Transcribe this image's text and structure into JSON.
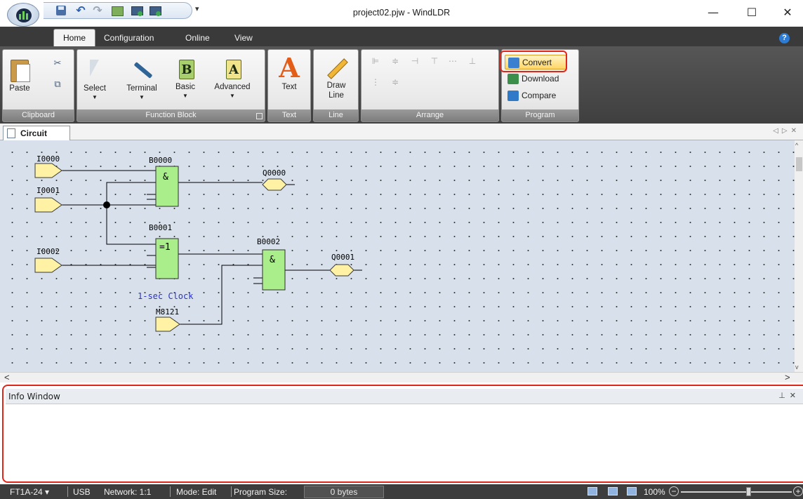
{
  "window": {
    "title": "project02.pjw - WindLDR",
    "minimize": "—",
    "maximize": "☐",
    "close": "✕"
  },
  "qat": {
    "more": "▾",
    "undo": "↶",
    "redo": "↷"
  },
  "tabs": [
    {
      "label": "Home",
      "active": true
    },
    {
      "label": "Configuration"
    },
    {
      "label": "Online"
    },
    {
      "label": "View"
    }
  ],
  "help": "?",
  "ribbon": {
    "clipboard": {
      "label": "Clipboard",
      "paste": "Paste",
      "cut_icon": "✂",
      "copy_icon": "⧉"
    },
    "function_block": {
      "label": "Function Block",
      "select": "Select",
      "terminal": "Terminal",
      "basic": "Basic",
      "advanced": "Advanced",
      "basic_glyph": "B",
      "advanced_glyph": "A"
    },
    "text": {
      "label": "Text",
      "button": "Text",
      "glyph": "A"
    },
    "line": {
      "label": "Line",
      "button_line1": "Draw",
      "button_line2": "Line"
    },
    "arrange": {
      "label": "Arrange"
    },
    "program": {
      "label": "Program",
      "convert": "Convert",
      "download": "Download",
      "compare": "Compare"
    }
  },
  "document_tab": {
    "label": "Circuit",
    "controls": "◁▷✕"
  },
  "circuit": {
    "inputs": [
      "I0000",
      "I0001",
      "I0002"
    ],
    "special_input": {
      "label": "M8121",
      "comment": "1-sec Clock"
    },
    "blocks": [
      {
        "tag": "B0000",
        "op": "&"
      },
      {
        "tag": "B0001",
        "op": "=1"
      },
      {
        "tag": "B0002",
        "op": "&"
      }
    ],
    "outputs": [
      "Q0000",
      "Q0001"
    ]
  },
  "scroll": {
    "left": "<",
    "right": ">",
    "up": "^",
    "down": "v"
  },
  "info_window": {
    "title": "Info Window",
    "controls": "⊥✕"
  },
  "status": {
    "plc": "FT1A-24",
    "plc_caret": "▾",
    "comm": "USB",
    "network": "Network: 1:1",
    "mode": "Mode: Edit",
    "program_size_label": "Program Size:",
    "program_size": "0 bytes",
    "zoom": "100%",
    "zoom_minus": "−",
    "zoom_plus": "+"
  }
}
